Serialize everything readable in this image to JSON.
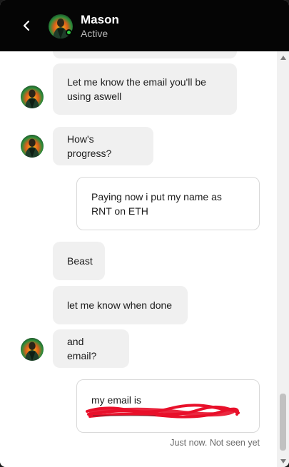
{
  "header": {
    "contact_name": "Mason",
    "status": "Active"
  },
  "messages": [
    {
      "from": "contact",
      "text": "Let me know the email you'll be using aswell"
    },
    {
      "from": "contact",
      "text": "How's progress?"
    },
    {
      "from": "self",
      "text": "Paying now i put my name as RNT on ETH"
    },
    {
      "from": "contact",
      "text": "Beast"
    },
    {
      "from": "contact",
      "text": "let me know when done"
    },
    {
      "from": "contact",
      "text": "and email?"
    },
    {
      "from": "self",
      "text": "my email is"
    }
  ],
  "last_message_meta": "Just now. Not seen yet",
  "colors": {
    "header_bg": "#050505",
    "incoming_bubble": "#f0f0f0",
    "outgoing_border": "#d9d9d9",
    "online": "#2ecc40",
    "redaction": "#e8102a"
  },
  "icons": {
    "back": "chevron-left-icon",
    "scroll_up": "triangle-up-icon",
    "scroll_down": "triangle-down-icon"
  }
}
